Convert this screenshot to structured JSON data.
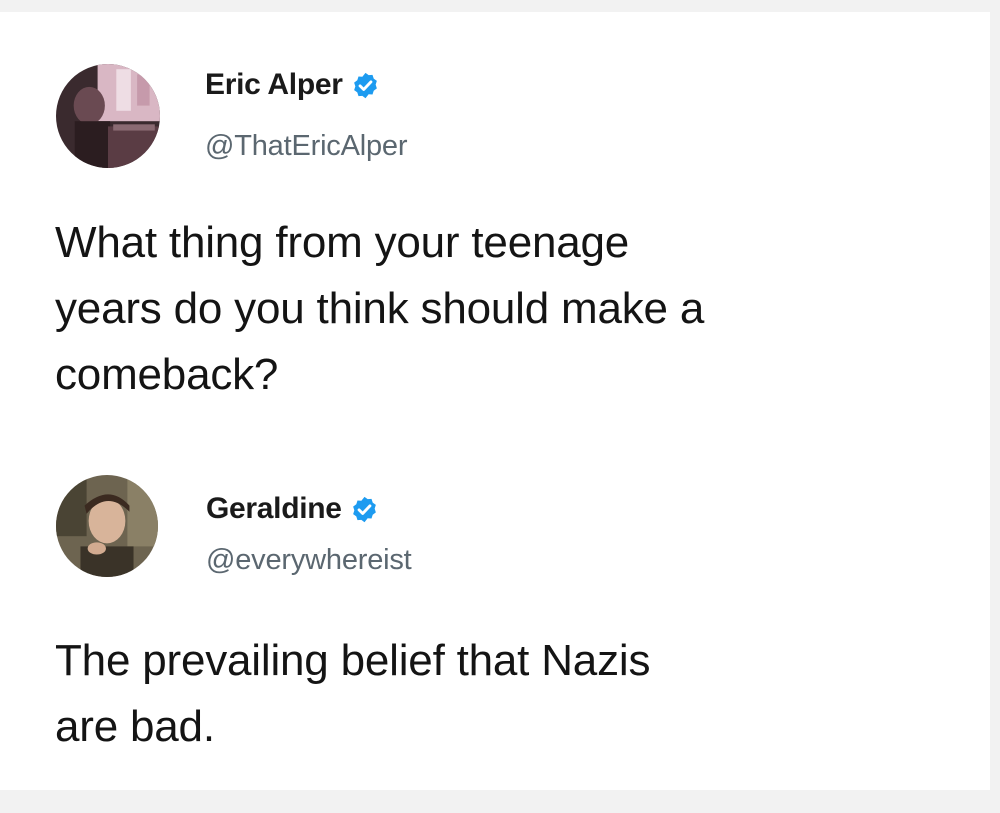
{
  "tweets": [
    {
      "author": {
        "name": "Eric Alper",
        "handle": "@ThatEricAlper",
        "verified": true,
        "avatar_icon": "avatar-photo"
      },
      "text_lines": [
        "What thing from your teenage",
        "years do you think should make a",
        "comeback?"
      ]
    },
    {
      "author": {
        "name": "Geraldine",
        "handle": "@everywhereist",
        "verified": true,
        "avatar_icon": "avatar-photo"
      },
      "text_lines": [
        "The prevailing belief that Nazis",
        "are bad."
      ]
    }
  ],
  "colors": {
    "verified_badge": "#1d9bf0",
    "handle": "#5b6770",
    "text": "#141414"
  }
}
